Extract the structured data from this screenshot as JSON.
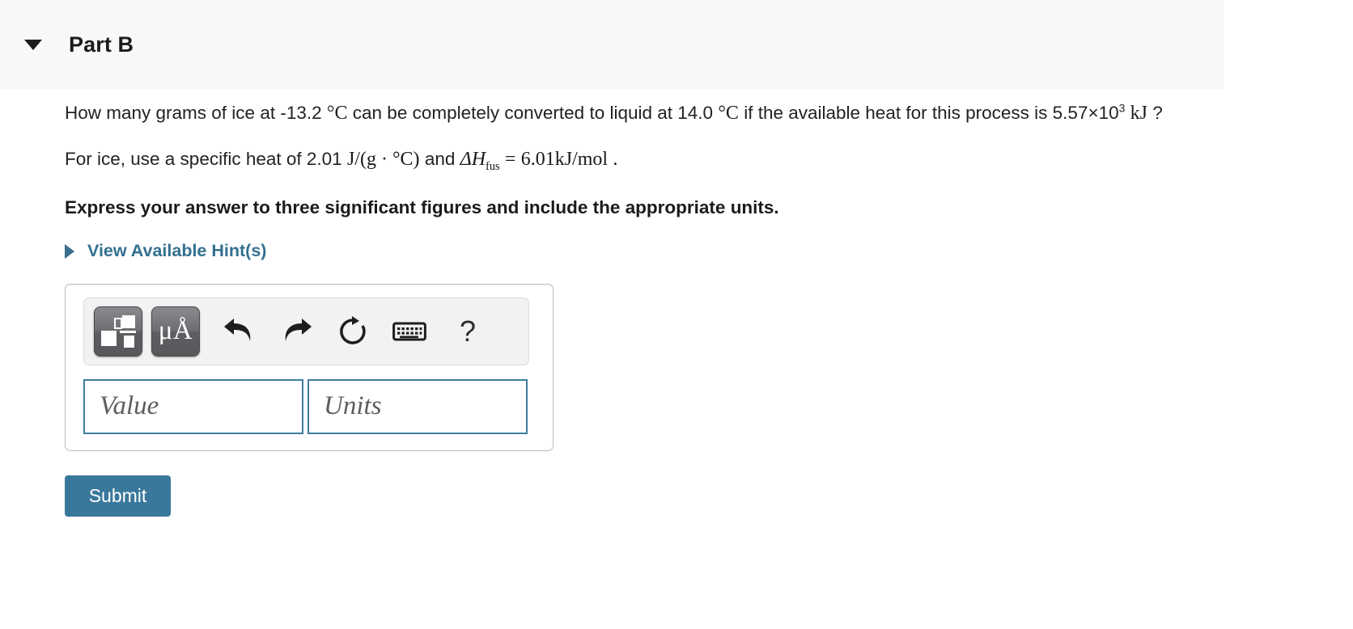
{
  "part": {
    "title": "Part B",
    "toggle_icon": "triangle-down-icon"
  },
  "question": {
    "line1_a": "How many grams of ice at -13.2",
    "line1_degc_1": "°C",
    "line1_b": "can be completely converted to liquid at 14.0",
    "line1_degc_2": "°C",
    "line1_c": "if the available heat for this process is",
    "line2_value": "5.57×10",
    "line2_exponent": "3",
    "line2_unit": "kJ",
    "line2_qmark": "?",
    "given_a": "For ice, use a specific heat of 2.01",
    "given_specific_heat": "J/(g · °C)",
    "given_b": "and",
    "given_delta_h": "ΔH",
    "given_delta_h_sub": "fus",
    "given_equals": "=",
    "given_enthalpy": "6.01kJ/mol",
    "given_period": ".",
    "instruction": "Express your answer to three significant figures and include the appropriate units."
  },
  "hints": {
    "label": "View Available Hint(s)",
    "caret_icon": "triangle-right-icon"
  },
  "answer": {
    "toolbar": {
      "template_button_label": "math-template-button",
      "units_button_label": "μÅ",
      "undo_label": "undo-arrow-icon",
      "redo_label": "redo-arrow-icon",
      "reset_label": "reset-circular-arrow-icon",
      "keyboard_label": "keyboard-icon",
      "help_label": "?"
    },
    "value_placeholder": "Value",
    "units_placeholder": "Units",
    "value_text": "",
    "units_text": ""
  },
  "submit": {
    "label": "Submit"
  },
  "colors": {
    "accent": "#3a789b",
    "link": "#34708f",
    "header_bg": "#f8f8f8",
    "input_border": "#3e7e9e",
    "toolbar_bg": "#f2f2f2"
  }
}
